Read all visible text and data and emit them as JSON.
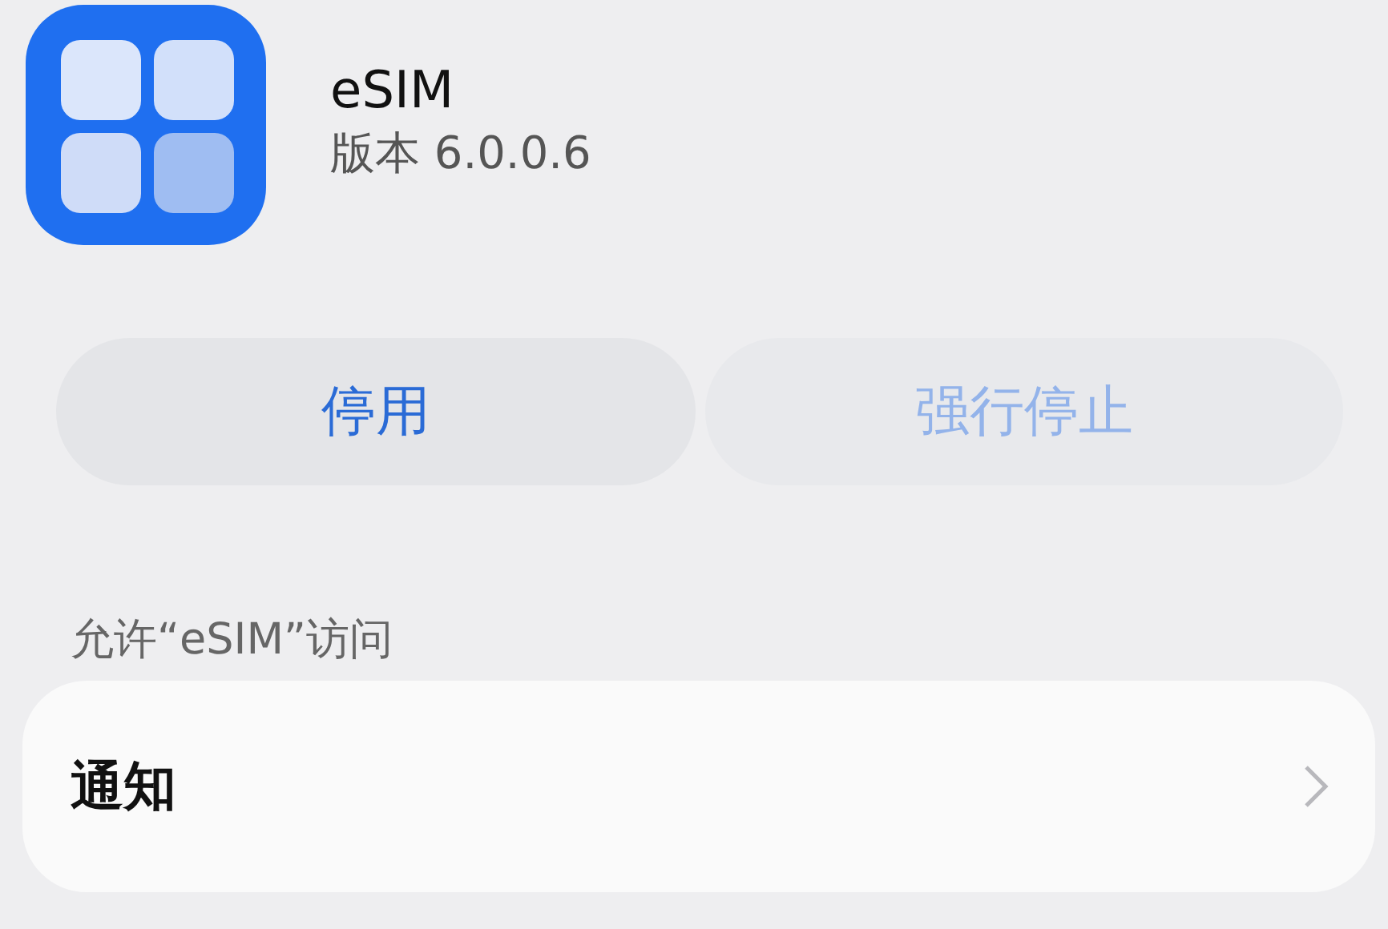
{
  "app": {
    "name": "eSIM",
    "version": "版本 6.0.0.6"
  },
  "buttons": [
    {
      "label": "停用",
      "disabled": false
    },
    {
      "label": "强行停止",
      "disabled": true
    }
  ],
  "section": {
    "title": "允许“eSIM”访问"
  },
  "items": [
    {
      "label": "通知"
    }
  ]
}
